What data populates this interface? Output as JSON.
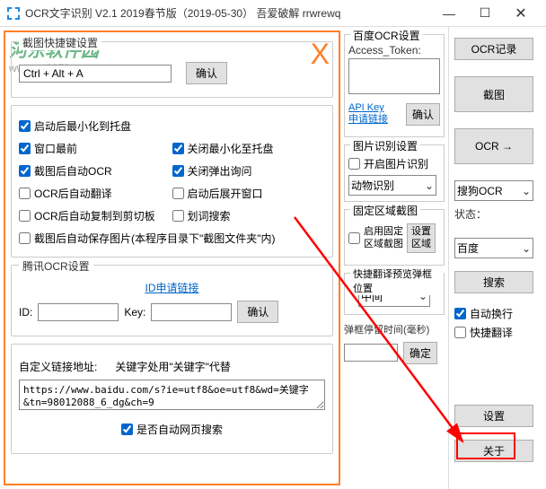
{
  "titlebar": {
    "title": "OCR文字识别 V2.1   2019春节版（2019-05-30）  吾爱破解 rrwrewq"
  },
  "watermark": {
    "logo": "河东软件园",
    "url": "www.pc0359.cn"
  },
  "hotkey": {
    "section_title": "截图快捷键设置",
    "value": "Ctrl + Alt + A",
    "confirm": "确认"
  },
  "options_section": {
    "title": "",
    "items": [
      {
        "label": "启动后最小化到托盘",
        "checked": true
      },
      {
        "label": "窗口最前",
        "checked": true
      },
      {
        "label": "关闭最小化至托盘",
        "checked": true
      },
      {
        "label": "截图后自动OCR",
        "checked": true
      },
      {
        "label": "关闭弹出询问",
        "checked": true
      },
      {
        "label": "OCR后自动翻译",
        "checked": false
      },
      {
        "label": "启动后展开窗口",
        "checked": false
      },
      {
        "label": "OCR后自动复制到剪切板",
        "checked": false
      },
      {
        "label": "划词搜索",
        "checked": false
      },
      {
        "label": "截图后自动保存图片(本程序目录下\"截图文件夹\"内)",
        "checked": false
      }
    ]
  },
  "tencent": {
    "title": "腾讯OCR设置",
    "link": "ID申请链接",
    "id_label": "ID:",
    "key_label": "Key:",
    "confirm": "确认"
  },
  "custom_link": {
    "title": "",
    "label": "自定义链接地址:",
    "hint": "关键字处用\"关键字\"代替",
    "value": "https://www.baidu.com/s?ie=utf8&oe=utf8&wd=关键字&tn=98012088_6_dg&ch=9",
    "auto_search_label": "是否自动网页搜索",
    "auto_search_checked": true
  },
  "baidu": {
    "title": "百度OCR设置",
    "token_label": "Access_Token:",
    "api_link": "API Key\n申请链接",
    "confirm": "确认"
  },
  "pic_rec": {
    "title": "图片识别设置",
    "enable_label": "开启图片识别",
    "enable_checked": false,
    "select": "动物识别"
  },
  "fixed_area": {
    "title": "固定区域截图",
    "enable_label": "启用固定\n区域截图",
    "setting_btn": "设置\n区域"
  },
  "popup": {
    "title": "快捷翻译预览弹框位置",
    "select": "中间",
    "stay_label": "弹框停留时间(毫秒)",
    "confirm": "确定"
  },
  "right": {
    "ocr_record": "OCR记录",
    "screenshot": "截图",
    "ocr_btn": "OCR   →",
    "engine_select": "搜狗OCR",
    "status_label": "状态：",
    "trans_select": "百度",
    "search_btn": "搜索",
    "auto_wrap_label": "自动换行",
    "auto_wrap_checked": true,
    "quick_trans_label": "快捷翻译",
    "quick_trans_checked": false,
    "settings_btn": "设置",
    "about_btn": "关于"
  }
}
